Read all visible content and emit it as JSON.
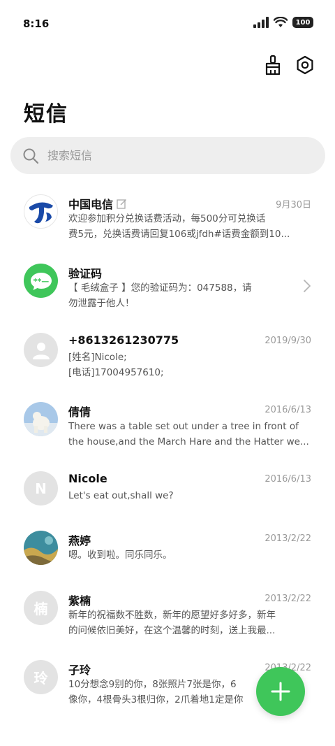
{
  "status": {
    "time": "8:16",
    "battery": "100"
  },
  "header": {
    "title": "短信"
  },
  "search": {
    "placeholder": "搜索短信"
  },
  "colors": {
    "accent": "#3fc65a",
    "unicom_blue": "#1a4aa8",
    "avatar_grey": "#e3e3e3"
  },
  "conversations": [
    {
      "name": "中国电信",
      "date": "9月30日",
      "line1": "欢迎参加积分兑换话费活动，每500分可兑换话",
      "line2": "费5元，兑换话费请回复106或jfdh#话费金额到10...",
      "avatar": "china-telecom-logo-icon"
    },
    {
      "name": "验证码",
      "date": "",
      "line1": "【 毛绒盒子 】您的验证码为：047588，请",
      "line2": "勿泄露于他人！",
      "avatar": "message-bubble-icon"
    },
    {
      "name": "+8613261230775",
      "date": "2019/9/30",
      "line1": "[姓名]Nicole;",
      "line2": "[电话]17004957610;",
      "avatar": "person-icon"
    },
    {
      "name": "倩倩",
      "date": "2016/6/13",
      "line1": "There was a table set out under a tree in front of",
      "line2": "the house,and the March Hare and the Hatter we...",
      "avatar": "polar-bear-photo"
    },
    {
      "name": "Nicole",
      "date": "2016/6/13",
      "line1": "Let's eat out,shall we?",
      "line2": "",
      "letter": "N"
    },
    {
      "name": "燕婷",
      "date": "2013/2/22",
      "line1": "嗯。收到啦。同乐同乐。",
      "line2": "",
      "avatar": "landscape-photo"
    },
    {
      "name": "紫楠",
      "date": "2013/2/22",
      "line1": "新年的祝福数不胜数，新年的愿望好多好多，新年",
      "line2": "的问候依旧美好，在这个温馨的时刻，送上我最...",
      "letter": "楠"
    },
    {
      "name": "子玲",
      "date": "2013/2/22",
      "line1": "10分想念9别的你，8张照片7张是你，6",
      "line2": "像你，4根骨头3根归你，2爪着地1定是你",
      "letter": "玲"
    }
  ]
}
